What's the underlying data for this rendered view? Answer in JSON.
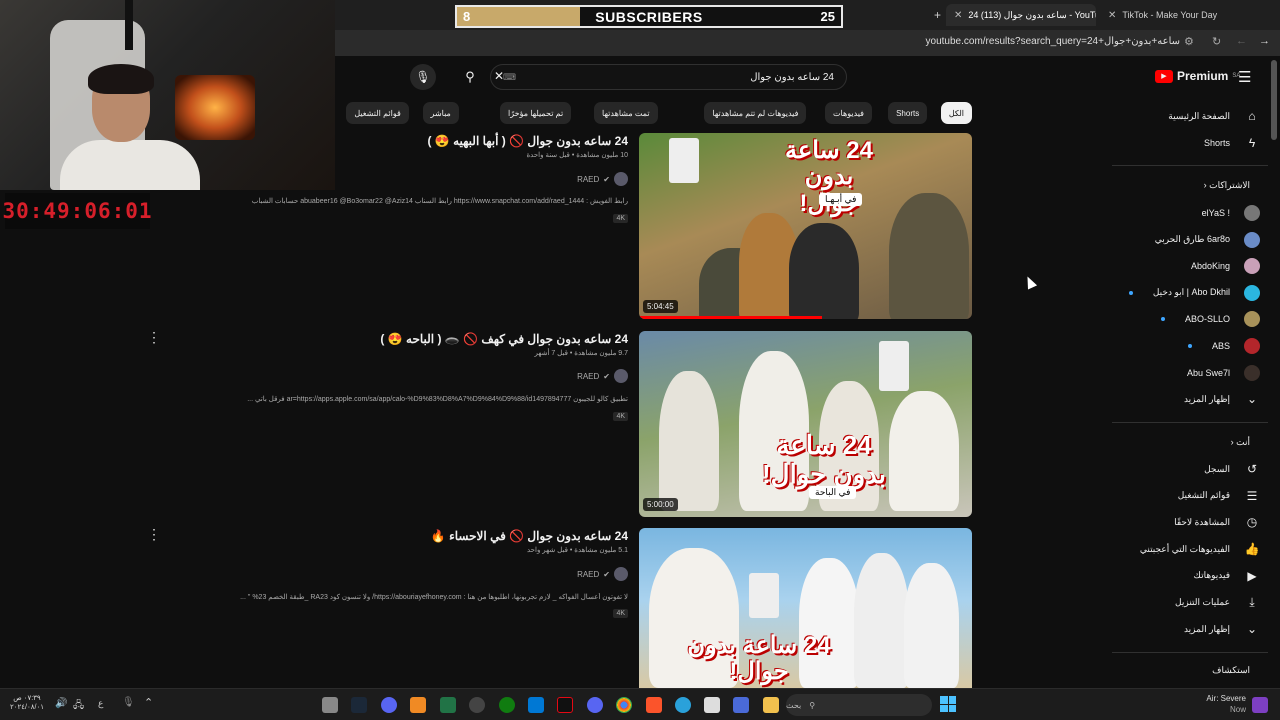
{
  "browser": {
    "tabs": [
      {
        "label": "24 ساعه بدون جوال (113) - YouTube"
      },
      {
        "label": "TikTok - Make Your Day"
      }
    ],
    "url": "youtube.com/results?search_query=24+ساعه+بدون+جوال"
  },
  "stream": {
    "timer": "30:49:06:01",
    "subgoal": {
      "current": "8",
      "label": "SUBSCRIBERS",
      "goal": "25",
      "fraction": 0.32
    }
  },
  "youtube": {
    "logo": "Premium",
    "region": "SA",
    "search": {
      "query": "24 ساعه بدون جوال"
    },
    "chips": [
      "الكل",
      "Shorts",
      "فيديوهات",
      "فيديوهات لم تتم مشاهدتها",
      "تمت مشاهدتها",
      "تم تحميلها مؤخرًا",
      "مباشر",
      "قوائم التشغيل"
    ],
    "results": [
      {
        "title": "24 ساعه بدون جوال 🚫 ( أبها البهيه 😍 )",
        "meta": "10 مليون مشاهدة • قبل سنة واحدة",
        "channel": "RAED",
        "desc": "رابط الفويش : https://www.snapchat.com/add/raed_1444 رابط السناب abuabeer16 @Bo3omar22 @Aziz14 حسابات الشباب",
        "badge": "4K",
        "duration": "5:04:45",
        "thumb_text": "24 ساعة بدون جوال!",
        "thumb_sub": "في أبـهـا"
      },
      {
        "title": "24 ساعه بدون جوال في كهف 🚫 🕳️ ( الباحه 😍 )",
        "meta": "9.7 مليون مشاهدة • قبل 7 أشهر",
        "channel": "RAED",
        "desc": "تطبيق كالو للجيبون ar=https://apps.apple.com/sa/app/calo-%D9%83%D8%A7%D9%84%D9%88/id1497894777 فرقل باتي ...",
        "badge": "4K",
        "duration": "5:00:00",
        "thumb_text": "24 ساعة بدون جوال!",
        "thumb_sub": "في الباحة"
      },
      {
        "title": "24 ساعه بدون جوال 🚫 في الاحساء 🔥",
        "meta": "5.1 مليون مشاهدة • قبل شهر واحد",
        "channel": "RAED",
        "desc": "لا تفوتون أعسال الفواكه _ لازم تجربونها، اطلبوها من هنا : https://abouriayefhoney.com/ ولا تنسون كود RA23 _طبقة الخصم 23% \" ...",
        "badge": "4K",
        "duration": "",
        "thumb_text": "24 ساعة بدون جوال!",
        "thumb_sub": ""
      }
    ],
    "sidebar": {
      "main": [
        {
          "label": "الصفحة الرئيسية",
          "icon": "home-icon"
        },
        {
          "label": "Shorts",
          "icon": "shorts-icon"
        }
      ],
      "subs_header": "الاشتراكات",
      "subs": [
        {
          "label": "! elYaS",
          "color": "#777",
          "live": false
        },
        {
          "label": "6ar8o طارق الحربي",
          "color": "#6a8cc7",
          "live": false
        },
        {
          "label": "AbdoKing",
          "color": "#c9a0b8",
          "live": false
        },
        {
          "label": "Abo Dkhil | ابو دخيل",
          "color": "#2bb6e0",
          "live": true
        },
        {
          "label": "ABO-SLLO",
          "color": "#a8925a",
          "live": true
        },
        {
          "label": "ABS",
          "color": "#b3262b",
          "live": true
        },
        {
          "label": "Abu Swe7l",
          "color": "#3a2f2a",
          "live": false
        }
      ],
      "show_more": "إظهار المزيد",
      "you_header": "أنت",
      "you": [
        {
          "label": "السجل",
          "icon": "history-icon"
        },
        {
          "label": "قوائم التشغيل",
          "icon": "playlist-icon"
        },
        {
          "label": "المشاهدة لاحقًا",
          "icon": "clock-icon"
        },
        {
          "label": "الفيديوهات التي أعجبتني",
          "icon": "like-icon"
        },
        {
          "label": "فيديوهاتك",
          "icon": "video-icon"
        },
        {
          "label": "عمليات التنزيل",
          "icon": "download-icon"
        },
        {
          "label": "إظهار المزيد",
          "icon": "chevron-down-icon"
        }
      ],
      "explore_header": "استكشاف"
    }
  },
  "taskbar": {
    "search": "بحث",
    "weather": "Air: Severe",
    "weather_sub": "Now",
    "time": "٠٧:٣٩ ص",
    "date": "٢٠٢٤/٠٨/٠١",
    "lang": "ع"
  }
}
